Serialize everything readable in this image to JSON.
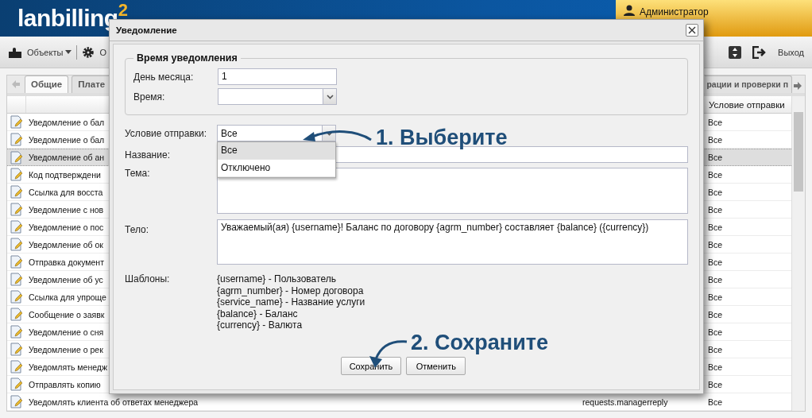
{
  "header": {
    "logo": "lanbilling",
    "logo_mark": "2",
    "user": "Администратор"
  },
  "toolbar": {
    "menu": "Объекты",
    "cut_item": "О",
    "logout": "Выход"
  },
  "tabs": [
    {
      "label": "Общие",
      "selected": true
    },
    {
      "label": "Плате",
      "selected": false
    },
    {
      "label": "рации и проверки п",
      "selected": false
    }
  ],
  "table": {
    "columns": [
      "Условие отправки"
    ],
    "rows": [
      {
        "name": "Уведомление о бал",
        "condition": "Все",
        "selected": false
      },
      {
        "name": "Уведомление о бал",
        "condition": "Все",
        "selected": false
      },
      {
        "name": "Уведомление об ан",
        "condition": "Все",
        "selected": true
      },
      {
        "name": "Код подтверждени",
        "condition": "Все",
        "selected": false
      },
      {
        "name": "Ссылка для восста",
        "condition": "Все",
        "selected": false
      },
      {
        "name": "Уведомление с нов",
        "condition": "Все",
        "selected": false
      },
      {
        "name": "Уведомление о пос",
        "condition": "Все",
        "selected": false
      },
      {
        "name": "Уведомление об ок",
        "condition": "Все",
        "selected": false
      },
      {
        "name": "Отправка документ",
        "condition": "Все",
        "selected": false
      },
      {
        "name": "Уведомление об ус",
        "condition": "Все",
        "selected": false
      },
      {
        "name": "Ссылка для упроще",
        "condition": "Все",
        "selected": false
      },
      {
        "name": "Сообщение о заявк",
        "condition": "Все",
        "selected": false
      },
      {
        "name": "Уведомление о сня",
        "condition": "Все",
        "selected": false
      },
      {
        "name": "Уведомление о рек",
        "condition": "Все",
        "selected": false
      },
      {
        "name": "Уведомлять менедж",
        "condition": "Все",
        "selected": false
      },
      {
        "name": "Отправлять копию",
        "condition": "Все",
        "selected": false
      },
      {
        "name": "Уведомлять клиента об ответах менеджера",
        "code": "requests.managerreply",
        "condition": "Все",
        "selected": false
      }
    ]
  },
  "dialog": {
    "title": "Уведомление",
    "fieldset": {
      "legend": "Время уведомления",
      "day_label": "День месяца:",
      "day_value": "1",
      "time_label": "Время:"
    },
    "condition": {
      "label": "Условие отправки:",
      "value": "Все",
      "options": [
        {
          "label": "Все",
          "selected": true
        },
        {
          "label": "Отключено",
          "selected": false
        }
      ]
    },
    "name_label": "Название:",
    "subject_label": "Тема:",
    "body": {
      "label": "Тело:",
      "value": "Уважаемый(ая) {username}! Баланс по договору {agrm_number} составляет {balance} ({currency})"
    },
    "templates": {
      "label": "Шаблоны:",
      "items": [
        "{username} - Пользователь",
        "{agrm_number} - Номер договора",
        "{service_name} - Название услуги",
        "{balance} - Баланс",
        "{currency} - Валюта"
      ]
    },
    "buttons": [
      "Сохранить",
      "Отменить"
    ]
  },
  "annotations": [
    "1. Выберите",
    "2. Сохраните"
  ]
}
